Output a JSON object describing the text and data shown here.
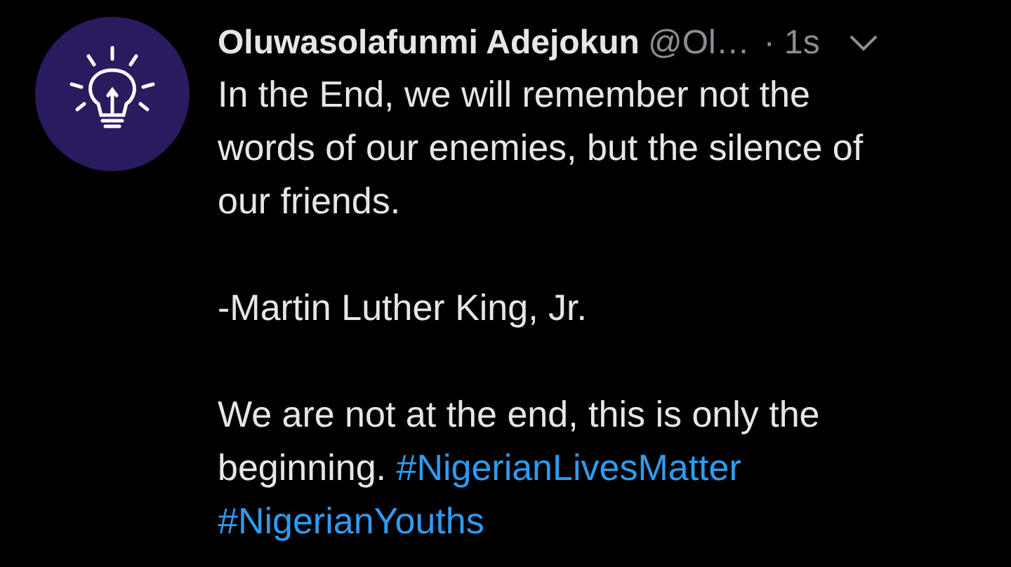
{
  "tweet": {
    "author_name": "Oluwasolafunmi Adejokun",
    "handle": "@Ol…",
    "time": "· 1s",
    "paragraphs": [
      [
        [
          {
            "kind": "text",
            "text": "In the End, we will remember not the"
          }
        ],
        [
          {
            "kind": "text",
            "text": "words of our enemies, but the silence of"
          }
        ],
        [
          {
            "kind": "text",
            "text": "our friends."
          }
        ]
      ],
      [
        [
          {
            "kind": "text",
            "text": "-Martin Luther King, Jr."
          }
        ]
      ],
      [
        [
          {
            "kind": "text",
            "text": "We are not at the end, this is only the"
          }
        ],
        [
          {
            "kind": "text",
            "text": "beginning. "
          },
          {
            "kind": "hashtag",
            "text": "#NigerianLivesMatter"
          }
        ],
        [
          {
            "kind": "hashtag",
            "text": "#NigerianYouths"
          }
        ]
      ]
    ]
  }
}
